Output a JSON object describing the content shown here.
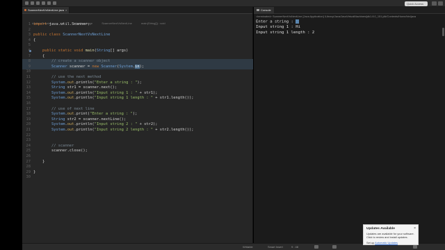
{
  "toolbar": {
    "quick_access": "Quick Access"
  },
  "editor": {
    "tabs": [
      {
        "label": "ScannerNextVsNextLine.java",
        "active": true
      },
      {
        "label": "YouTubeJavaTutorial",
        "active": false
      },
      {
        "label": "bin",
        "active": false
      },
      {
        "label": "default package",
        "active": false
      },
      {
        "label": "ScannerNextVsNextLine",
        "active": false
      },
      {
        "label": "main(String[]) : void",
        "active": false
      }
    ]
  },
  "code_lines": [
    {
      "n": "1",
      "html": "<span class='k'>import</span> java.util.Scanner;"
    },
    {
      "n": "2",
      "html": ""
    },
    {
      "n": "3",
      "html": "<span class='k'>public class</span> <span class='t'>ScannerNextVsNextLine</span>"
    },
    {
      "n": "4",
      "html": "{"
    },
    {
      "n": "5",
      "html": ""
    },
    {
      "n": "6",
      "html": "    <span class='k'>public static void</span> <span class='v'>main</span>(<span class='t'>String</span>[] args)",
      "marker": true
    },
    {
      "n": "7",
      "html": "    {"
    },
    {
      "n": "8",
      "html": "        <span class='c'>// create a scanner object</span>",
      "hl": true
    },
    {
      "n": "9",
      "html": "        <span class='t'>Scanner</span> scanner = <span class='k'>new</span> <span class='t'>Scanner</span>(<span class='t'>System</span>.<span class='sel'>in</span>);",
      "hl": true
    },
    {
      "n": "10",
      "html": ""
    },
    {
      "n": "11",
      "html": "        <span class='c'>// use the next method</span>"
    },
    {
      "n": "12",
      "html": "        <span class='t'>System</span>.<span class='f'>out</span>.println(<span class='s'>\"Enter a string : \"</span>);"
    },
    {
      "n": "13",
      "html": "        <span class='t'>String</span> str1 = scanner.next();"
    },
    {
      "n": "14",
      "html": "        <span class='t'>System</span>.<span class='f'>out</span>.println(<span class='s'>\"Input string 1 : \"</span> + str1);"
    },
    {
      "n": "15",
      "html": "        <span class='t'>System</span>.<span class='f'>out</span>.println(<span class='s'>\"Input string 1 length : \"</span> + str1.length());"
    },
    {
      "n": "16",
      "html": ""
    },
    {
      "n": "17",
      "html": "        <span class='c'>// use of next line</span>"
    },
    {
      "n": "18",
      "html": "        <span class='t'>System</span>.<span class='f'>out</span>.print(<span class='s'>\"Enter a string : \"</span>);"
    },
    {
      "n": "19",
      "html": "        <span class='t'>String</span> str2 = scanner.nextLine();"
    },
    {
      "n": "20",
      "html": "        <span class='t'>System</span>.<span class='f'>out</span>.println(<span class='s'>\"Input string 2 : \"</span> + str2);"
    },
    {
      "n": "21",
      "html": "        <span class='t'>System</span>.<span class='f'>out</span>.println(<span class='s'>\"Input string 2 length : \"</span> + str2.length());"
    },
    {
      "n": "22",
      "html": ""
    },
    {
      "n": "23",
      "html": ""
    },
    {
      "n": "24",
      "html": "        <span class='c'>// scanner</span>"
    },
    {
      "n": "25",
      "html": "        scanner.close();"
    },
    {
      "n": "26",
      "html": ""
    },
    {
      "n": "27",
      "html": "    }"
    },
    {
      "n": "28",
      "html": ""
    },
    {
      "n": "29",
      "html": "}"
    },
    {
      "n": "30",
      "html": ""
    }
  ],
  "console": {
    "tab_label": "Console",
    "terminated_line": "<terminated> ScannerNextVsNextLine [Java Application] /Library/Java/JavaVirtualMachines/jdk1.8.0_151.jdk/Contents/Home/bin/java",
    "output_lines": [
      "Enter a string :",
      "Input string 1 : Hi",
      "Input string 1 length : 2"
    ]
  },
  "status": {
    "writable": "Writable",
    "insert_mode": "Smart Insert",
    "position": "9 : 48"
  },
  "notification": {
    "title": "Updates Available",
    "close": "×",
    "body": "Updates are available for your software. Click to review and install updates.",
    "link_prefix": "Set up ",
    "link_text": "Automatic Updates"
  },
  "colors": {
    "editor_bg": "#262626",
    "keyword": "#cc7832",
    "type": "#6fa1d8",
    "string": "#9cc06a",
    "comment": "#7c8b97"
  }
}
